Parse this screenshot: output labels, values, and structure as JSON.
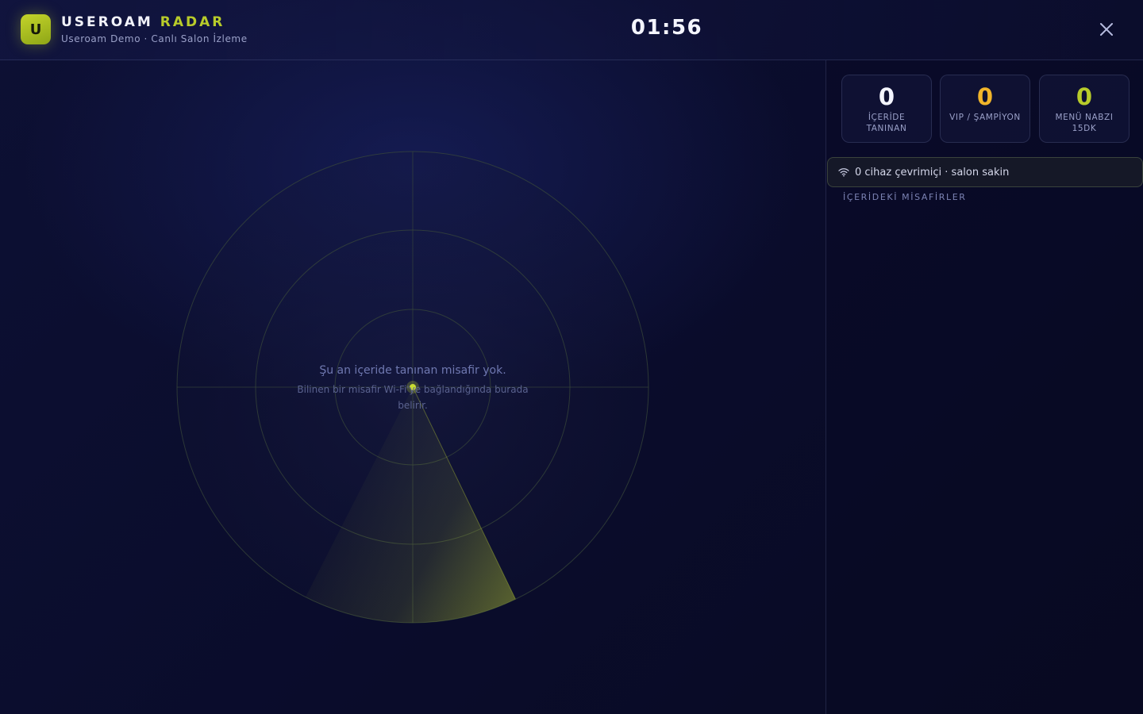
{
  "header": {
    "logo_letter": "U",
    "brand_main": "USEROAM",
    "brand_accent": "RADAR",
    "subtitle": "Useroam Demo · Canlı Salon İzleme",
    "clock": "01:56",
    "close_icon": "close-icon"
  },
  "radar": {
    "empty_title": "Şu an içeride tanınan misafir yok.",
    "empty_description": "Bilinen bir misafir Wi-Fi'ye bağlandığında burada belirir.",
    "rings": 3,
    "sweep_color": "#c8dc32"
  },
  "stats": [
    {
      "value": "0",
      "label": "İÇERİDE TANINAN",
      "color": "#f4f5ff"
    },
    {
      "value": "0",
      "label": "VIP / ŞAMPİYON",
      "color": "#f1b52a"
    },
    {
      "value": "0",
      "label": "MENÜ NABZI 15DK",
      "color": "#b8cc2a"
    }
  ],
  "wifi": {
    "icon": "wifi-icon",
    "status_text": "0 cihaz çevrimiçi · salon sakin"
  },
  "guests": {
    "section_title": "İÇERİDEKİ MİSAFİRLER",
    "items": []
  },
  "colors": {
    "accent": "#b8cc2a",
    "vip": "#f1b52a",
    "background": "#0a0c2a"
  }
}
